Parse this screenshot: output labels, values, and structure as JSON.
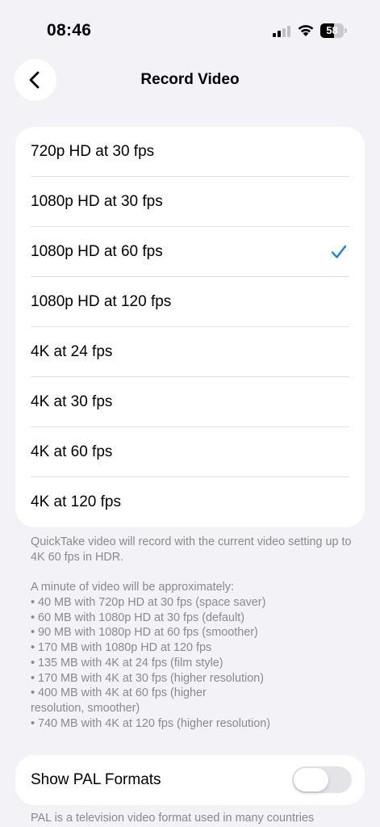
{
  "status_bar": {
    "time": "08:46",
    "battery_level": "58",
    "battery_fraction": 0.58,
    "signal_bars_active": 2,
    "signal_bars_total": 4
  },
  "nav": {
    "title": "Record Video",
    "back_icon": "chevron-left-icon"
  },
  "options": [
    {
      "label": "720p HD at 30 fps",
      "selected": false
    },
    {
      "label": "1080p HD at 30 fps",
      "selected": false
    },
    {
      "label": "1080p HD at 60 fps",
      "selected": true
    },
    {
      "label": "1080p HD at 120 fps",
      "selected": false
    },
    {
      "label": "4K at 24 fps",
      "selected": false
    },
    {
      "label": "4K at 30 fps",
      "selected": false
    },
    {
      "label": "4K at 60 fps",
      "selected": false
    },
    {
      "label": "4K at 120 fps",
      "selected": false
    }
  ],
  "footnotes": {
    "quicktake": "QuickTake video will record with the current video setting up to 4K 60 fps in HDR.",
    "size_intro": "A minute of video will be approximately:",
    "sizes": [
      "• 40 MB with 720p HD at 30 fps (space saver)",
      "• 60 MB with 1080p HD at 30 fps (default)",
      "• 90 MB with 1080p HD at 60 fps (smoother)",
      "• 170 MB with 1080p HD at 120 fps",
      "• 135 MB with 4K at 24 fps (film style)",
      "• 170 MB with 4K at 30 fps (higher resolution)",
      "• 400 MB with 4K at 60 fps (higher resolution, smoother)",
      "• 740 MB with 4K at 120 fps (higher resolution)"
    ]
  },
  "pal": {
    "label": "Show PAL Formats",
    "enabled": false,
    "note": "PAL is a television video format used in many countries"
  },
  "colors": {
    "accent": "#0a84ff",
    "background": "#f2f2f7",
    "card": "#ffffff",
    "secondary_text": "#8a8a8e",
    "toggle_off": "#e3e3e8",
    "separator": "#e2e2e6"
  }
}
